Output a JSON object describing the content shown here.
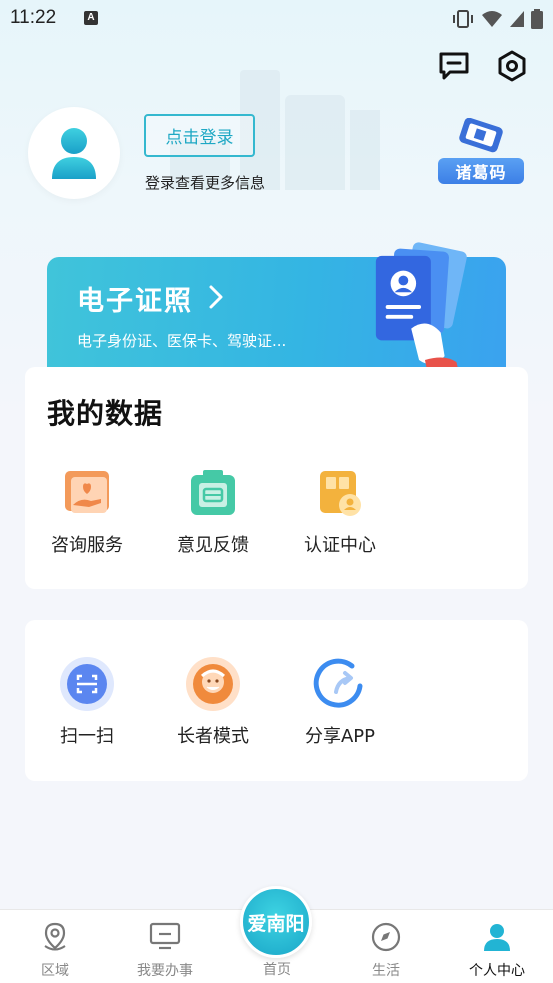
{
  "status_bar": {
    "time": "11:22",
    "indicator": "A"
  },
  "top_actions": {
    "message_icon": "message-icon",
    "settings_icon": "settings-icon"
  },
  "profile": {
    "login_label": "点击登录",
    "login_subtitle": "登录查看更多信息"
  },
  "zhuge": {
    "label": "诸葛码"
  },
  "e_certificate": {
    "title": "电子证照",
    "subtitle": "电子身份证、医保卡、驾驶证..."
  },
  "my_data": {
    "title": "我的数据",
    "items": [
      {
        "label": "咨询服务",
        "icon": "consult-icon",
        "color": "#f0884a"
      },
      {
        "label": "意见反馈",
        "icon": "feedback-icon",
        "color": "#45c9a6"
      },
      {
        "label": "认证中心",
        "icon": "certification-icon",
        "color": "#f3b23d"
      }
    ]
  },
  "tools": {
    "items": [
      {
        "label": "扫一扫",
        "icon": "scan-icon",
        "color": "#5b86f0"
      },
      {
        "label": "长者模式",
        "icon": "elder-mode-icon",
        "color": "#f08a3c"
      },
      {
        "label": "分享APP",
        "icon": "share-icon",
        "color": "#3c8cf0"
      }
    ]
  },
  "tabbar": {
    "tabs": [
      {
        "label": "区域",
        "icon": "location-icon"
      },
      {
        "label": "我要办事",
        "icon": "monitor-icon"
      },
      {
        "label": "首页",
        "icon": "home-logo"
      },
      {
        "label": "生活",
        "icon": "compass-icon"
      },
      {
        "label": "个人中心",
        "icon": "person-icon"
      }
    ],
    "home_logo_text": "爱南阳",
    "active": "个人中心"
  }
}
